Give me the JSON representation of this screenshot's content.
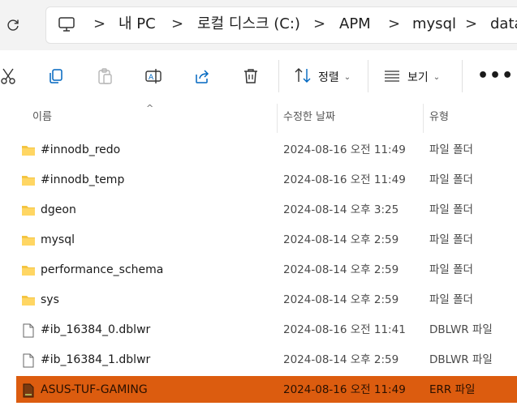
{
  "breadcrumb": {
    "items": [
      "내 PC",
      "로컬 디스크 (C:)",
      "APM",
      "mysql",
      "data"
    ],
    "separator": ">"
  },
  "toolbar": {
    "sort_label": "정렬",
    "view_label": "보기",
    "more_label": "•••"
  },
  "columns": {
    "name": "이름",
    "date": "수정한 날짜",
    "type": "유형"
  },
  "files": [
    {
      "name": "#innodb_redo",
      "date": "2024-08-16 오전 11:49",
      "type": "파일 폴더",
      "icon": "folder-icon"
    },
    {
      "name": "#innodb_temp",
      "date": "2024-08-16 오전 11:49",
      "type": "파일 폴더",
      "icon": "folder-icon"
    },
    {
      "name": "dgeon",
      "date": "2024-08-14 오후 3:25",
      "type": "파일 폴더",
      "icon": "folder-icon"
    },
    {
      "name": "mysql",
      "date": "2024-08-14 오후 2:59",
      "type": "파일 폴더",
      "icon": "folder-icon"
    },
    {
      "name": "performance_schema",
      "date": "2024-08-14 오후 2:59",
      "type": "파일 폴더",
      "icon": "folder-icon"
    },
    {
      "name": "sys",
      "date": "2024-08-14 오후 2:59",
      "type": "파일 폴더",
      "icon": "folder-icon"
    },
    {
      "name": "#ib_16384_0.dblwr",
      "date": "2024-08-16 오전 11:41",
      "type": "DBLWR 파일",
      "icon": "file-icon"
    },
    {
      "name": "#ib_16384_1.dblwr",
      "date": "2024-08-14 오후 2:59",
      "type": "DBLWR 파일",
      "icon": "file-icon"
    },
    {
      "name": "ASUS-TUF-GAMING",
      "date": "2024-08-16 오전 11:49",
      "type": "ERR 파일",
      "icon": "err-file-icon",
      "highlighted": true
    }
  ],
  "colors": {
    "highlight": "#dc5c0f",
    "folder": "#f4c542",
    "accent": "#0067c0"
  }
}
